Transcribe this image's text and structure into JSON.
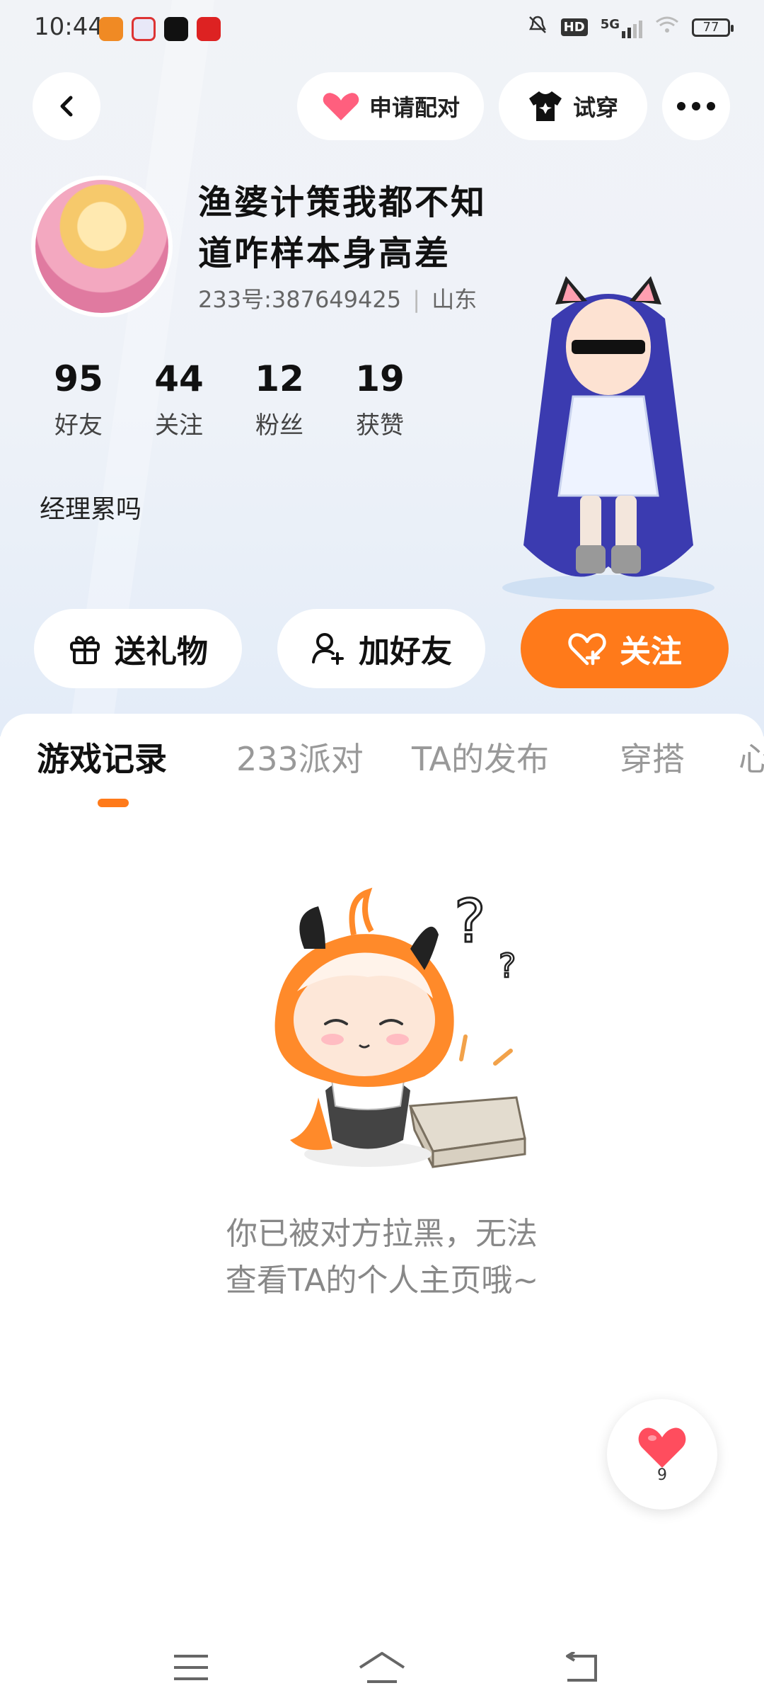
{
  "status_bar": {
    "time": "10:44",
    "network": "5G",
    "hd": "HD",
    "battery": "77"
  },
  "header": {
    "pair_label": "申请配对",
    "tryon_label": "试穿"
  },
  "profile": {
    "nickname": "渔婆计策我都不知道咋样本身高差",
    "id_line": "233号:387649425",
    "location": "山东",
    "bio": "经理累吗",
    "stats": [
      {
        "value": "95",
        "label": "好友"
      },
      {
        "value": "44",
        "label": "关注"
      },
      {
        "value": "12",
        "label": "粉丝"
      },
      {
        "value": "19",
        "label": "获赞"
      }
    ]
  },
  "actions": {
    "gift": "送礼物",
    "add_friend": "加好友",
    "follow": "关注"
  },
  "tabs": [
    "游戏记录",
    "233派对",
    "TA的发布",
    "穿搭",
    "心"
  ],
  "empty_message": "你已被对方拉黑，无法查看TA的个人主页哦~",
  "like_count": "9",
  "colors": {
    "accent": "#ff7a1a",
    "heart": "#ff4d5e"
  }
}
